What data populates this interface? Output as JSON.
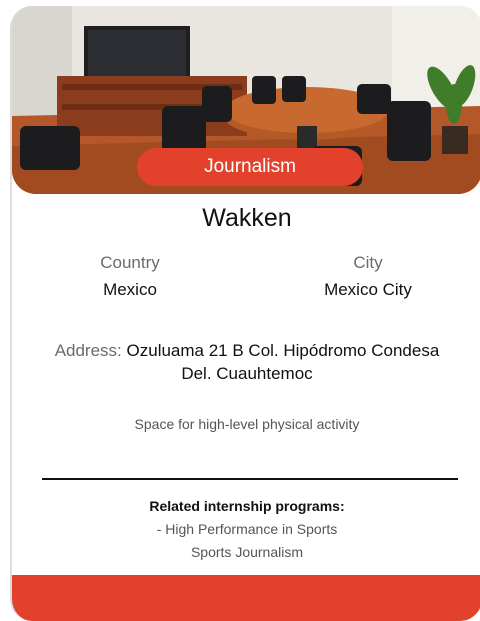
{
  "card": {
    "category": "Journalism",
    "name": "Wakken",
    "country_label": "Country",
    "country": "Mexico",
    "city_label": "City",
    "city": "Mexico City",
    "address_label": "Address:",
    "address": "Ozuluama 21 B Col. Hipódromo Condesa Del. Cuauhtemoc",
    "description": "Space for high-level physical activity",
    "related_heading": "Related internship programs:",
    "related_programs": [
      "- High Performance in Sports",
      "Sports Journalism"
    ]
  },
  "colors": {
    "accent": "#e2422b"
  }
}
